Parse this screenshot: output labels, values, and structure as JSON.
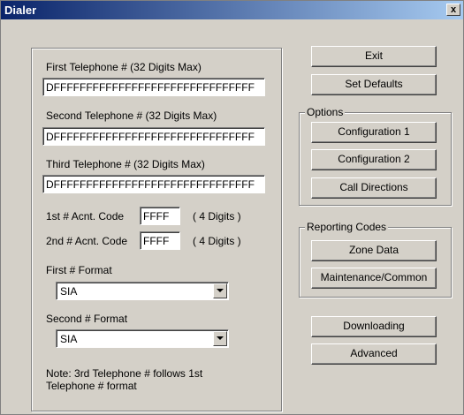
{
  "window": {
    "title": "Dialer",
    "close_label": "x"
  },
  "phones": [
    {
      "label": "First Telephone # (32 Digits Max)",
      "value": "DFFFFFFFFFFFFFFFFFFFFFFFFFFFFFFF"
    },
    {
      "label": "Second Telephone # (32 Digits Max)",
      "value": "DFFFFFFFFFFFFFFFFFFFFFFFFFFFFFFF"
    },
    {
      "label": "Third Telephone # (32 Digits Max)",
      "value": "DFFFFFFFFFFFFFFFFFFFFFFFFFFFFFFF"
    }
  ],
  "account_codes": [
    {
      "label": "1st # Acnt. Code",
      "value": "FFFF",
      "hint": "( 4 Digits )"
    },
    {
      "label": "2nd # Acnt. Code",
      "value": "FFFF",
      "hint": "( 4 Digits )"
    }
  ],
  "formats": [
    {
      "label": "First # Format",
      "value": "SIA"
    },
    {
      "label": "Second # Format",
      "value": "SIA"
    }
  ],
  "note": "Note: 3rd Telephone # follows 1st Telephone # format",
  "buttons": {
    "exit": "Exit",
    "set_defaults": "Set Defaults",
    "downloading": "Downloading",
    "advanced": "Advanced"
  },
  "options": {
    "legend": "Options",
    "config1": "Configuration 1",
    "config2": "Configuration 2",
    "call_directions": "Call Directions"
  },
  "reporting": {
    "legend": "Reporting Codes",
    "zone_data": "Zone Data",
    "maintenance": "Maintenance/Common"
  }
}
